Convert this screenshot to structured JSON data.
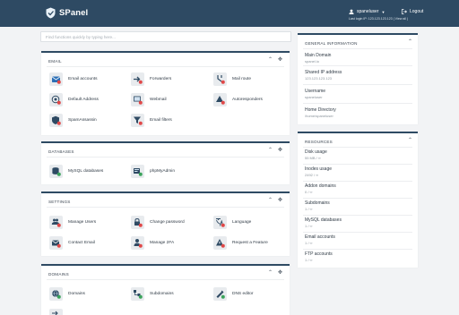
{
  "header": {
    "app_name": "SPanel",
    "username": "spaneluser",
    "logout_label": "Logout",
    "ip_line": "Last login IP: 123.123.123.123 | View all |"
  },
  "search": {
    "placeholder": "Find functions quickly by typing here..."
  },
  "email_section": {
    "title": "EMAIL",
    "items": [
      {
        "label": "Email accounts",
        "icon": "envelope-icon"
      },
      {
        "label": "Forwarders",
        "icon": "forward-arrow-icon"
      },
      {
        "label": "Mail route",
        "icon": "route-icon"
      },
      {
        "label": "Default Address",
        "icon": "at-sign-icon"
      },
      {
        "label": "Webmail",
        "icon": "webmail-icon"
      },
      {
        "label": "Autoresponders",
        "icon": "autoresponder-icon"
      },
      {
        "label": "SpamAssassin",
        "icon": "shield-icon"
      },
      {
        "label": "Email filters",
        "icon": "filter-icon"
      }
    ]
  },
  "databases_section": {
    "title": "DATABASES",
    "items": [
      {
        "label": "MySQL databases",
        "icon": "database-icon"
      },
      {
        "label": "phpMyAdmin",
        "icon": "php-icon"
      }
    ]
  },
  "settings_section": {
    "title": "SETTINGS",
    "items": [
      {
        "label": "Manage Users",
        "icon": "users-icon"
      },
      {
        "label": "Change password",
        "icon": "lock-icon"
      },
      {
        "label": "Language",
        "icon": "language-icon"
      },
      {
        "label": "Contact Email",
        "icon": "contact-email-icon"
      },
      {
        "label": "Manage 2FA",
        "icon": "two-factor-icon"
      },
      {
        "label": "Request a Feature",
        "icon": "request-feature-icon"
      }
    ]
  },
  "domains_section": {
    "title": "DOMAINS",
    "items": [
      {
        "label": "Domains",
        "icon": "globe-icon"
      },
      {
        "label": "Subdomains",
        "icon": "subdomains-icon"
      },
      {
        "label": "DNS editor",
        "icon": "dns-icon"
      }
    ]
  },
  "general_info": {
    "title": "GENERAL INFORMATION",
    "rows": [
      {
        "key": "Main Domain",
        "value": "spanel.io"
      },
      {
        "key": "Shared IP address",
        "value": "123.123.123.123"
      },
      {
        "key": "Username",
        "value": "spaneluser"
      },
      {
        "key": "Home Directory",
        "value": "/home/spaneluser"
      }
    ]
  },
  "resources": {
    "title": "RESOURCES",
    "rows": [
      {
        "key": "Disk usage",
        "value": "55 MB / ∞"
      },
      {
        "key": "Inodes usage",
        "value": "2492 / ∞"
      },
      {
        "key": "Addon domains",
        "value": "0 / ∞"
      },
      {
        "key": "Subdomains",
        "value": "1 / ∞"
      },
      {
        "key": "MySQL databases",
        "value": "1 / ∞"
      },
      {
        "key": "Email accounts",
        "value": "1 / ∞"
      },
      {
        "key": "FTP accounts",
        "value": "1 / ∞"
      }
    ]
  },
  "colors": {
    "header_bg": "#2e4a63",
    "accent_blue": "#2b6fb6",
    "accent_green": "#3aa35b",
    "accent_red": "#e04848",
    "accent_orange": "#e79a23"
  }
}
